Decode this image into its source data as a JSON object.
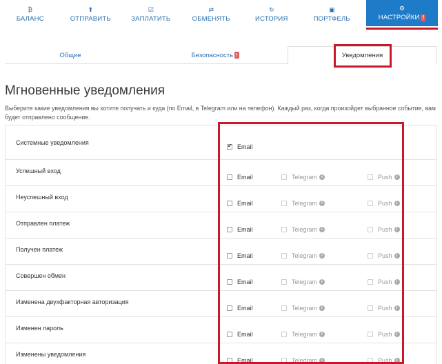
{
  "nav": {
    "items": [
      {
        "icon": "₿",
        "label": "БАЛАНС"
      },
      {
        "icon": "⬆",
        "label": "ОТПРАВИТЬ"
      },
      {
        "icon": "☑",
        "label": "ЗАПЛАТИТЬ"
      },
      {
        "icon": "⇄",
        "label": "ОБМЕНЯТЬ"
      },
      {
        "icon": "↻",
        "label": "ИСТОРИЯ"
      },
      {
        "icon": "▣",
        "label": "ПОРТФЕЛЬ"
      },
      {
        "icon": "⚙",
        "label": "НАСТРОЙКИ",
        "badge": "!"
      }
    ]
  },
  "tabs": {
    "general": "Общие",
    "security": "Безопасность",
    "security_badge": "!",
    "notifications": "Уведомления"
  },
  "heading": "Мгновенные уведомления",
  "description": "Выберите какие уведомления вы хотите получать и куда (по Email, в Telegram или на телефон). Каждый раз, когда произойдет выбранное событие, вам будет отправлено сообщение.",
  "channels": {
    "email": "Email",
    "telegram": "Telegram",
    "push": "Push",
    "info": "i"
  },
  "rows": [
    {
      "label": "Системные уведомления"
    },
    {
      "label": "Успешный вход"
    },
    {
      "label": "Неуспешный вход"
    },
    {
      "label": "Отправлен платеж"
    },
    {
      "label": "Получен платеж"
    },
    {
      "label": "Совершен обмен"
    },
    {
      "label": "Изменена двухфакторная авторизация"
    },
    {
      "label": "Изменен пароль"
    },
    {
      "label": "Изменены уведомления"
    }
  ],
  "colors": {
    "accent": "#1e7bc8",
    "highlight": "#c8182a",
    "badge": "#e55a5a"
  }
}
